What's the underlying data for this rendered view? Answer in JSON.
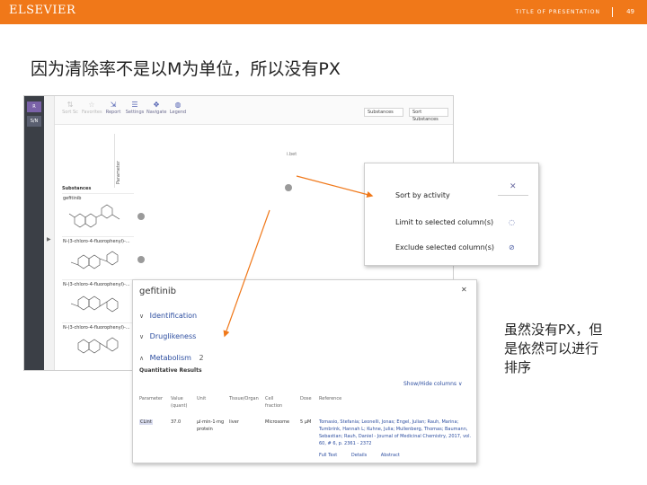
{
  "header": {
    "brand": "ELSEVIER",
    "presentation_title": "TITLE OF PRESENTATION",
    "page_number": "49"
  },
  "slide_title": "因为清除率不是以M为单位，所以没有PX",
  "note": "虽然没有PX，但\n是依然可以进行\n排序",
  "screenshot": {
    "rail": [
      {
        "label": "R"
      },
      {
        "label": "S/N"
      }
    ],
    "toolbar": [
      {
        "label": "Sort Sc",
        "icon": "sort-icon"
      },
      {
        "label": "Favorites",
        "icon": "star-icon"
      },
      {
        "label": "Report",
        "icon": "report-icon"
      },
      {
        "label": "Settings",
        "icon": "settings-icon"
      },
      {
        "label": "Navigate",
        "icon": "navigate-icon"
      },
      {
        "label": "Legend",
        "icon": "legend-icon"
      }
    ],
    "selects": [
      {
        "label": "Substances"
      },
      {
        "label": "Sort Substances"
      }
    ],
    "column_header": "Parameter",
    "column_abbr": "i.bet",
    "substances_label": "Substances",
    "rows": [
      {
        "name": "gefitinib"
      },
      {
        "name": "N-(3-chloro-4-fluorophenyl)-..."
      },
      {
        "name": "N-(3-chloro-4-fluorophenyl)-..."
      },
      {
        "name": "N-(3-chloro-4-fluorophenyl)-..."
      }
    ]
  },
  "sort_popup": {
    "items": [
      {
        "label": "Sort by activity",
        "icon": ""
      },
      {
        "label": "Limit to selected column(s)",
        "icon": "filter-icon"
      },
      {
        "label": "Exclude selected column(s)",
        "icon": "exclude-icon"
      }
    ]
  },
  "detail_popup": {
    "title": "gefitinib",
    "sections": [
      {
        "label": "Identification",
        "count": ""
      },
      {
        "label": "Druglikeness",
        "count": ""
      },
      {
        "label": "Metabolism",
        "count": "2"
      }
    ],
    "subheading": "Quantitative Results",
    "show_hide": "Show/Hide columns",
    "table": {
      "headers": [
        "Parameter",
        "Value (quant)",
        "Unit",
        "Tissue/Organ",
        "Cell fraction",
        "Dose",
        "Reference"
      ],
      "row": {
        "parameter": "CLint",
        "value": "37.0",
        "unit": "μl·min-1·mg protein",
        "tissue": "liver",
        "cell_fraction": "Microsome",
        "dose": "5 μM",
        "reference": "Tomasio, Stefania; Leonelli, Jonas; Engel, Julian; Rauh, Marina; Tumbrink, Hannah L; Kuhne, Julia; Mullenberg, Thomas; Baumann, Sebastian; Rauh, Daniel - Journal of Medicinal Chemistry, 2017, vol. 60, # 6, p. 2361 - 2372"
      },
      "links": [
        "Full Text",
        "Details",
        "Abstract"
      ]
    }
  }
}
